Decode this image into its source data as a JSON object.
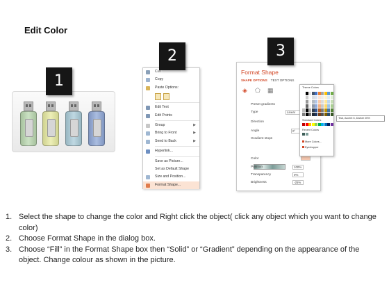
{
  "title": "Edit Color",
  "steps": {
    "one": "1",
    "two": "2",
    "three": "3"
  },
  "usb_colors": [
    "#b9d8b0",
    "#e7eaa0",
    "#a9cbd8",
    "#8ea7d6"
  ],
  "context_menu": {
    "cut": "Cut",
    "copy": "Copy",
    "paste_options": "Paste Options:",
    "edit_text": "Edit Text",
    "edit_points": "Edit Points",
    "group": "Group",
    "bring_to_front": "Bring to Front",
    "send_to_back": "Send to Back",
    "hyperlink": "Hyperlink...",
    "save_as_picture": "Save as Picture...",
    "set_default_shape": "Set as Default Shape",
    "size_position": "Size and Position...",
    "format_shape": "Format Shape..."
  },
  "format_pane": {
    "title": "Format Shape",
    "tab_shape": "SHAPE OPTIONS",
    "tab_text": "TEXT OPTIONS",
    "preset_gradients": "Preset gradients",
    "type_label": "Type",
    "type_value": "Linear",
    "direction_label": "Direction",
    "angle_label": "Angle",
    "angle_value": "0°",
    "gradient_stops": "Gradient stops",
    "color_label": "Color",
    "position_label": "Position",
    "position_value": "100%",
    "transparency_label": "Transparency",
    "transparency_value": "0%",
    "brightness_label": "Brightness",
    "brightness_value": "-25%"
  },
  "color_picker": {
    "theme_colors": "Theme Colors",
    "standard_colors": "Standard Colors",
    "recent_colors": "Recent Colors",
    "more_colors": "More Colors...",
    "eyedropper": "Eyedropper",
    "tooltip": "Teal, Accent 6, Darker 25%",
    "theme_top": [
      "#ffffff",
      "#000000",
      "#e7e6e6",
      "#44546a",
      "#4472c4",
      "#ed7d31",
      "#a5a5a5",
      "#ffc000",
      "#5b9bd5",
      "#70ad47"
    ],
    "standard": [
      "#c00000",
      "#ff0000",
      "#ffc000",
      "#ffff00",
      "#92d050",
      "#00b050",
      "#00b0f0",
      "#0070c0",
      "#002060",
      "#7030a0"
    ],
    "recent": [
      "#3f5f5a",
      "#7f9f9a"
    ]
  },
  "instructions": [
    {
      "num": "1.",
      "text": "Select the shape to change the color and Right click the object( click any object which you want to change color)"
    },
    {
      "num": "2.",
      "text": "Choose Format Shape in the dialog box."
    },
    {
      "num": "3.",
      "text": "Choose “Fill” in the Format Shape box then “Solid” or “Gradient” depending on the appearance of the object. Change colour as shown in the picture."
    }
  ]
}
